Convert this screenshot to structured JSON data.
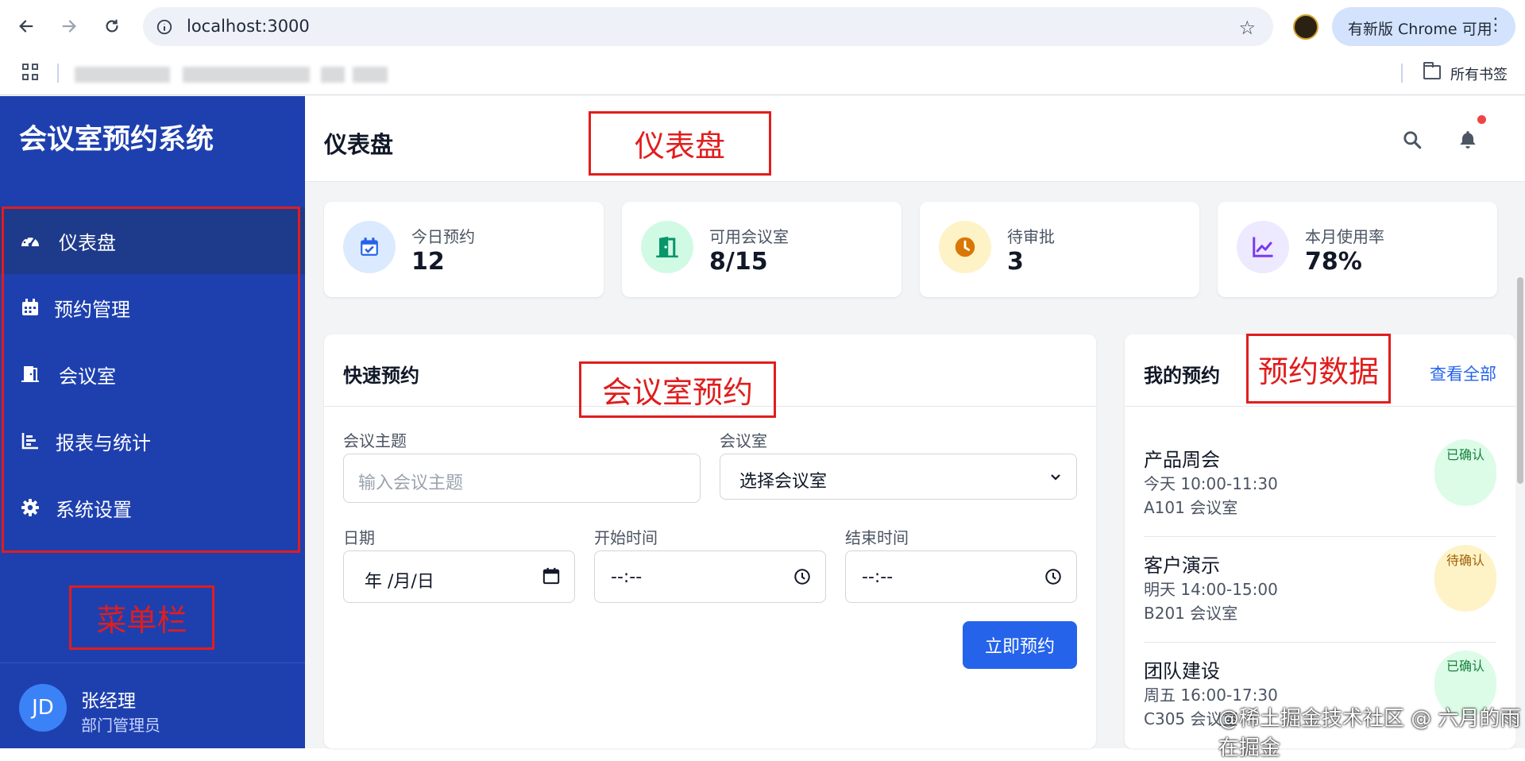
{
  "browser": {
    "url": "localhost:3000",
    "update_label": "有新版 Chrome 可用",
    "all_bookmarks": "所有书签"
  },
  "sidebar": {
    "brand": "会议室预约系统",
    "items": [
      {
        "label": "仪表盘",
        "icon": "gauge-icon",
        "active": true
      },
      {
        "label": "预约管理",
        "icon": "calendar-icon"
      },
      {
        "label": "会议室",
        "icon": "door-icon"
      },
      {
        "label": "报表与统计",
        "icon": "bar-chart-icon"
      },
      {
        "label": "系统设置",
        "icon": "gear-icon"
      }
    ],
    "user": {
      "initials": "JD",
      "name": "张经理",
      "role": "部门管理员"
    }
  },
  "header": {
    "title": "仪表盘"
  },
  "stats": [
    {
      "label": "今日预约",
      "value": "12",
      "icon": "calendar-check-icon",
      "color": "#2563eb",
      "bg": "#dbeafe"
    },
    {
      "label": "可用会议室",
      "value": "8/15",
      "icon": "door-open-icon",
      "color": "#059669",
      "bg": "#d1fae5"
    },
    {
      "label": "待审批",
      "value": "3",
      "icon": "clock-icon",
      "color": "#d97706",
      "bg": "#fef3c7"
    },
    {
      "label": "本月使用率",
      "value": "78%",
      "icon": "line-chart-icon",
      "color": "#7c3aed",
      "bg": "#ede9fe"
    }
  ],
  "quick_booking": {
    "title": "快速预约",
    "topic_label": "会议主题",
    "topic_placeholder": "输入会议主题",
    "room_label": "会议室",
    "room_value": "选择会议室",
    "date_label": "日期",
    "date_value": "年 /月/日",
    "start_label": "开始时间",
    "start_value": "--:--",
    "end_label": "结束时间",
    "end_value": "--:--",
    "submit": "立即预约"
  },
  "my_bookings": {
    "title": "我的预约",
    "view_all": "查看全部",
    "items": [
      {
        "title": "产品周会",
        "time": "今天 10:00-11:30",
        "room": "A101 会议室",
        "status": "已确认",
        "status_color": "#15803d",
        "status_bg": "#dcfce7"
      },
      {
        "title": "客户演示",
        "time": "明天 14:00-15:00",
        "room": "B201 会议室",
        "status": "待确认",
        "status_color": "#a16207",
        "status_bg": "#fef3c7"
      },
      {
        "title": "团队建设",
        "time": "周五 16:00-17:30",
        "room": "C305 会议室",
        "status": "已确认",
        "status_color": "#15803d",
        "status_bg": "#dcfce7"
      }
    ]
  },
  "annotations": {
    "dashboard": "仪表盘",
    "room_booking": "会议室预约",
    "booking_data": "预约数据",
    "menu_bar": "菜单栏"
  },
  "watermark": "@稀土掘金技术社区 @ 六月的雨在掘金"
}
